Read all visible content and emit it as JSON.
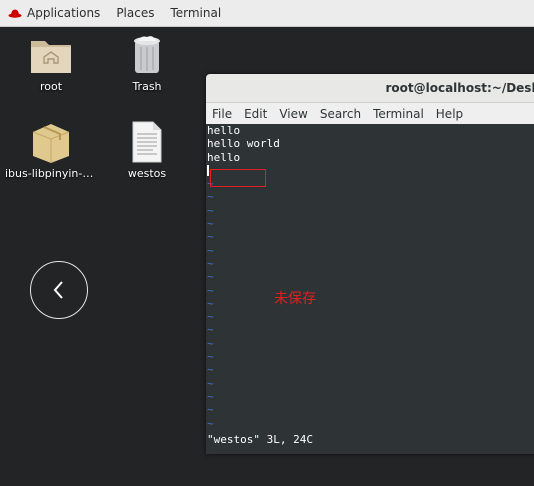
{
  "topbar": {
    "applications": "Applications",
    "places": "Places",
    "terminal": "Terminal"
  },
  "desktop": {
    "icons": [
      {
        "label": "root",
        "icon": "home-folder-icon"
      },
      {
        "label": "Trash",
        "icon": "trash-icon"
      },
      {
        "label": "ibus-libpinyin-1....",
        "icon": "package-icon"
      },
      {
        "label": "westos",
        "icon": "text-file-icon"
      }
    ]
  },
  "window": {
    "title": "root@localhost:~/Desktop",
    "menu": [
      "File",
      "Edit",
      "View",
      "Search",
      "Terminal",
      "Help"
    ]
  },
  "editor": {
    "lines": [
      "hello",
      "hello world",
      "hello"
    ],
    "tilde": "~",
    "status_line": "\"westos\" 3L, 24C"
  },
  "annotation": {
    "text": "未保存",
    "color": "#e02020"
  }
}
